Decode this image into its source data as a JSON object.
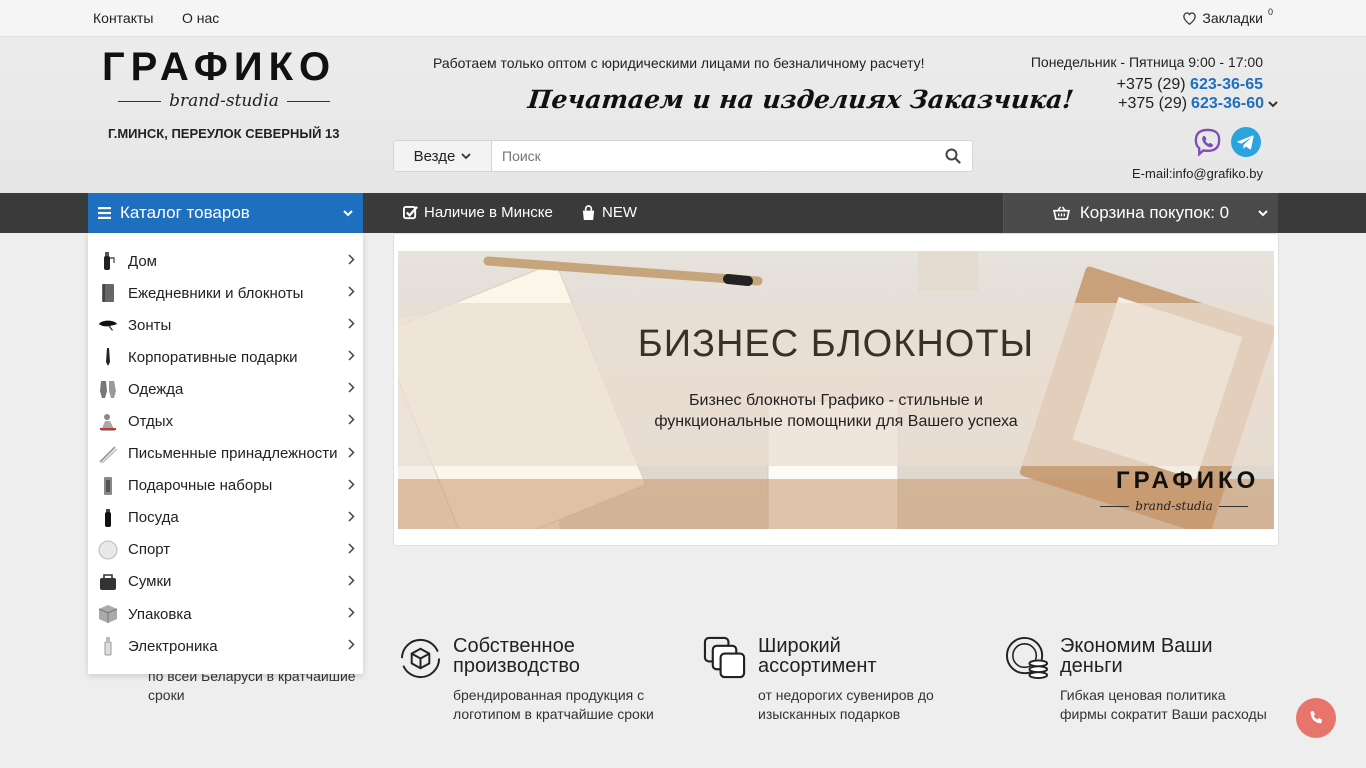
{
  "topbar": {
    "contacts": "Контакты",
    "about": "О нас",
    "bookmarks_label": "Закладки",
    "bookmarks_count": "0"
  },
  "header": {
    "logo_title": "ГРАФИКО",
    "logo_sub": "brand-studia",
    "address": "Г.МИНСК, ПЕРЕУЛОК СЕВЕРНЫЙ 13",
    "tagline": "Работаем только оптом с юридическими лицами по безналичному расчету!",
    "slogan": "Печатаем и на изделиях Заказчика!",
    "hours": "Понедельник - Пятница 9:00 - 17:00",
    "phone1_prefix": "+375 (29)",
    "phone1_number": "623-36-65",
    "phone2_prefix": "+375 (29)",
    "phone2_number": "623-36-60",
    "email_label": "E-mail:",
    "email": "info@grafiko.by"
  },
  "search": {
    "scope": "Везде",
    "placeholder": "Поиск"
  },
  "nav": {
    "catalog": "Каталог товаров",
    "in_stock": "Наличие в Минске",
    "new": "NEW",
    "cart": "Корзина покупок: 0"
  },
  "menu": {
    "items": [
      {
        "label": "Дом"
      },
      {
        "label": "Ежедневники и блокноты"
      },
      {
        "label": "Зонты"
      },
      {
        "label": "Корпоративные подарки"
      },
      {
        "label": "Одежда"
      },
      {
        "label": "Отдых"
      },
      {
        "label": "Письменные принадлежности"
      },
      {
        "label": "Подарочные наборы"
      },
      {
        "label": "Посуда"
      },
      {
        "label": "Спорт"
      },
      {
        "label": "Сумки"
      },
      {
        "label": "Упаковка"
      },
      {
        "label": "Электроника"
      }
    ]
  },
  "banner": {
    "title": "БИЗНЕС БЛОКНОТЫ",
    "line1": "Бизнес блокноты Графико - стильные и",
    "line2": "функциональные помощники для Вашего успеха",
    "logo": "ГРАФИКО",
    "logo_sub": "brand-studia"
  },
  "features": {
    "partial_line1": "по всей Беларуси в кратчайшие",
    "partial_line2": "сроки",
    "items": [
      {
        "title1": "Собственное",
        "title2": "производство",
        "text1": "брендированная продукция с",
        "text2": "логотипом в кратчайшие сроки"
      },
      {
        "title1": "Широкий",
        "title2": "ассортимент",
        "text1": "от недорогих сувениров до",
        "text2": "изысканных подарков"
      },
      {
        "title1": "Экономим Ваши",
        "title2": "деньги",
        "text1": "Гибкая ценовая политика",
        "text2": "фирмы сократит Ваши расходы"
      }
    ]
  },
  "colors": {
    "accent": "#1f6fbf",
    "navbar": "#3a3a3a",
    "call_button": "#e8756b"
  }
}
